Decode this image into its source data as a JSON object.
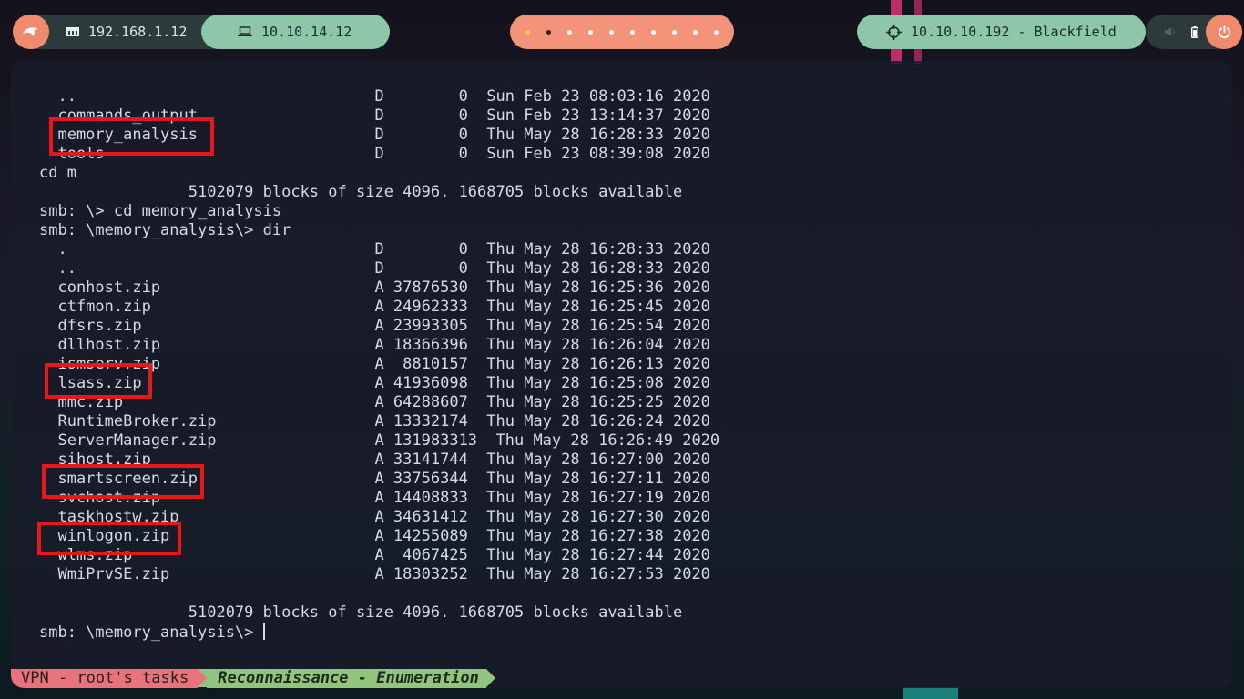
{
  "topbar": {
    "local_ip": "192.168.1.12",
    "vpn_ip": "10.10.14.12",
    "target": "10.10.10.192 - Blackfield",
    "workspace_count": 10,
    "active_workspace": 2
  },
  "terminal": {
    "lines": [
      "  ..                                D        0  Sun Feb 23 08:03:16 2020",
      "  commands_output                   D        0  Sun Feb 23 13:14:37 2020",
      "  memory_analysis                   D        0  Thu May 28 16:28:33 2020",
      "  tools                             D        0  Sun Feb 23 08:39:08 2020",
      "cd m",
      "                5102079 blocks of size 4096. 1668705 blocks available",
      "smb: \\> cd memory_analysis",
      "smb: \\memory_analysis\\> dir",
      "  .                                 D        0  Thu May 28 16:28:33 2020",
      "  ..                                D        0  Thu May 28 16:28:33 2020",
      "  conhost.zip                       A 37876530  Thu May 28 16:25:36 2020",
      "  ctfmon.zip                        A 24962333  Thu May 28 16:25:45 2020",
      "  dfsrs.zip                         A 23993305  Thu May 28 16:25:54 2020",
      "  dllhost.zip                       A 18366396  Thu May 28 16:26:04 2020",
      "  ismserv.zip                       A  8810157  Thu May 28 16:26:13 2020",
      "  lsass.zip                         A 41936098  Thu May 28 16:25:08 2020",
      "  mmc.zip                           A 64288607  Thu May 28 16:25:25 2020",
      "  RuntimeBroker.zip                 A 13332174  Thu May 28 16:26:24 2020",
      "  ServerManager.zip                 A 131983313  Thu May 28 16:26:49 2020",
      "  sihost.zip                        A 33141744  Thu May 28 16:27:00 2020",
      "  smartscreen.zip                   A 33756344  Thu May 28 16:27:11 2020",
      "  svchost.zip                       A 14408833  Thu May 28 16:27:19 2020",
      "  taskhostw.zip                     A 34631412  Thu May 28 16:27:30 2020",
      "  winlogon.zip                      A 14255089  Thu May 28 16:27:38 2020",
      "  wlms.zip                          A  4067425  Thu May 28 16:27:44 2020",
      "  WmiPrvSE.zip                      A 18303252  Thu May 28 16:27:53 2020",
      "",
      "                5102079 blocks of size 4096. 1668705 blocks available"
    ],
    "prompt": "smb: \\memory_analysis\\> ",
    "highlight_color": "#e8151b"
  },
  "tmux": {
    "session": "VPN - root's tasks",
    "window": "Reconnaissance - Enumeration"
  },
  "colors": {
    "accent_orange": "#f08a6c",
    "accent_green": "#8ec6a8",
    "tmux_red": "#e8737a",
    "tmux_green": "#93c47d"
  }
}
